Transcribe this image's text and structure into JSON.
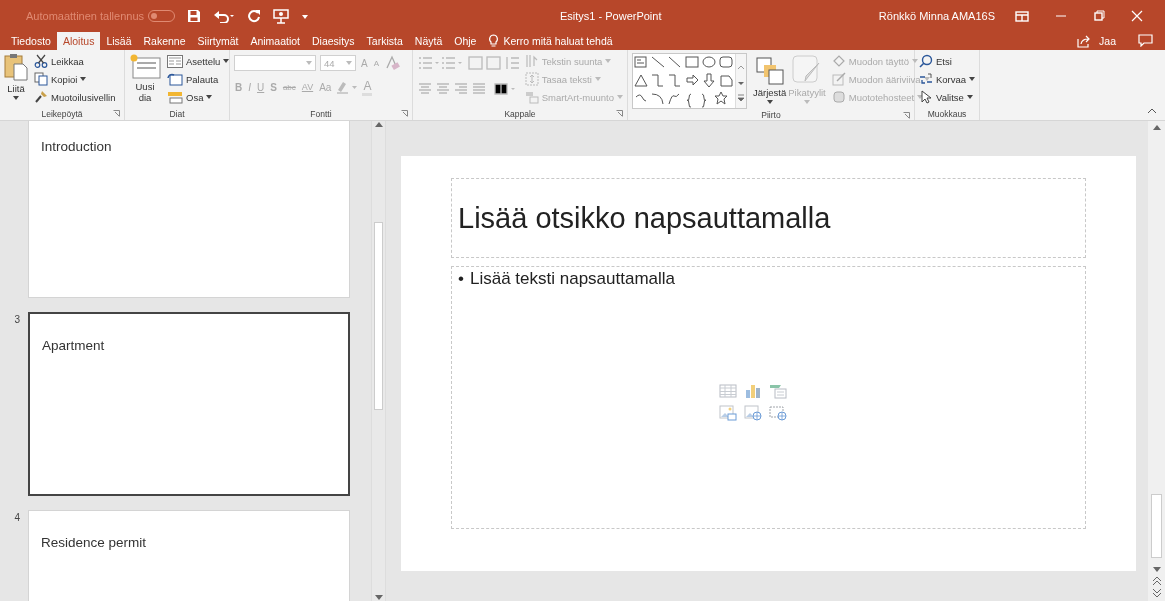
{
  "titlebar": {
    "autosave": {
      "label": "Automaattinen tallennus",
      "on": false
    },
    "title": "Esitys1  -  PowerPoint",
    "user": "Rönkkö Minna AMA16S"
  },
  "tabs": [
    {
      "label": "Tiedosto",
      "selected": false
    },
    {
      "label": "Aloitus",
      "selected": true
    },
    {
      "label": "Lisää",
      "selected": false
    },
    {
      "label": "Rakenne",
      "selected": false
    },
    {
      "label": "Siirtymät",
      "selected": false
    },
    {
      "label": "Animaatiot",
      "selected": false
    },
    {
      "label": "Diaesitys",
      "selected": false
    },
    {
      "label": "Tarkista",
      "selected": false
    },
    {
      "label": "Näytä",
      "selected": false
    },
    {
      "label": "Ohje",
      "selected": false
    }
  ],
  "tell_me": "Kerro mitä haluat tehdä",
  "share": "Jaa",
  "ribbon": {
    "clipboard": {
      "label": "Leikepöytä",
      "paste": "Liitä",
      "cut": "Leikkaa",
      "copy": "Kopioi",
      "format_painter": "Muotoilusivellin"
    },
    "slides": {
      "label": "Diat",
      "new_slide": "Uusi dia",
      "layout": "Asettelu",
      "reset": "Palauta",
      "section": "Osa"
    },
    "font": {
      "label": "Fontti",
      "disabled": true,
      "size": "44",
      "size_buttons": [
        "A",
        "A"
      ],
      "format_buttons": [
        "B",
        "I",
        "U",
        "S",
        "abc",
        "AV",
        "Aa"
      ],
      "color_button": "A"
    },
    "paragraph": {
      "label": "Kappale",
      "disabled": true,
      "text_direction": "Tekstin suunta",
      "align_text": "Tasaa teksti",
      "smartart": "SmartArt-muunto"
    },
    "drawing": {
      "label": "Piirto",
      "arrange": "Järjestä",
      "quick_styles": {
        "label": "Pikatyylit",
        "disabled": true
      },
      "shape_tools": [
        {
          "label": "Muodon täyttö",
          "disabled": true
        },
        {
          "label": "Muodon ääriviiva",
          "disabled": true
        },
        {
          "label": "Muototehosteet",
          "disabled": true
        }
      ]
    },
    "editing": {
      "label": "Muokkaus",
      "find": "Etsi",
      "replace": "Korvaa",
      "select": "Valitse"
    }
  },
  "thumbnails": [
    {
      "title": "Introduction",
      "selected": false
    },
    {
      "number": "3",
      "title": "Apartment",
      "selected": true
    },
    {
      "number": "4",
      "title": "Residence permit",
      "selected": false
    }
  ],
  "slide": {
    "title_placeholder": "Lisää otsikko napsauttamalla",
    "bullet": "•",
    "body_placeholder": "Lisää teksti napsauttamalla"
  }
}
